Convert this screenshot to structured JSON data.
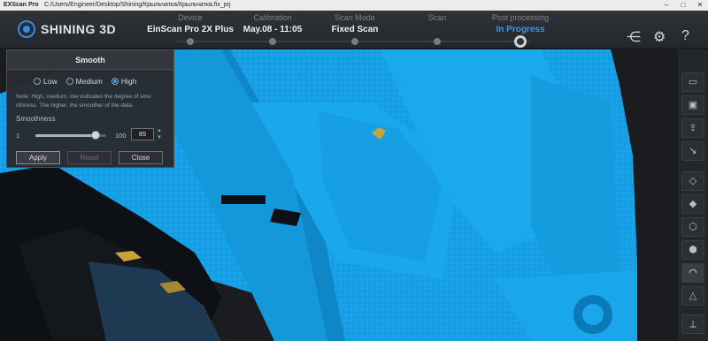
{
  "window": {
    "app_name": "EXScan Pro",
    "path": "C:/Users/Engineer/Desktop/Shining/Крыльчатка/Крыльчатка.fix_prj",
    "min": "–",
    "max": "□",
    "close": "✕"
  },
  "header": {
    "brand": "SHINING 3D",
    "steps": [
      {
        "label": "Device",
        "value": "EinScan Pro 2X Plus"
      },
      {
        "label": "Calibration",
        "value": "May.08 - 11:05"
      },
      {
        "label": "Scan Mode",
        "value": "Fixed Scan"
      },
      {
        "label": "Scan",
        "value": ""
      },
      {
        "label": "Post processing",
        "value": "In Progress"
      }
    ],
    "icons": [
      "share-icon",
      "settings-icon",
      "help-icon"
    ],
    "icon_glyphs": {
      "share": "⋲",
      "settings": "⚙",
      "help": "?"
    }
  },
  "smooth_panel": {
    "title": "Smooth",
    "options": [
      "Low",
      "Medium",
      "High"
    ],
    "selected": "High",
    "note": "Note: High, medium, low indicates the degree of smo othness. The higher, the smoother of the data.",
    "smoothness_label": "Smoothness",
    "min": "1",
    "max": "100",
    "value": "85",
    "slider_fraction": 0.85,
    "buttons": {
      "apply": "Apply",
      "reset": "Reset",
      "close": "Close"
    }
  },
  "sidebar": {
    "tools": [
      "open-folder-icon",
      "save-icon",
      "export-icon",
      "import-icon",
      "cube-front-icon",
      "cube-side-icon",
      "cube-top-icon",
      "cube-iso-icon",
      "smooth-tool-icon",
      "triangle-icon",
      "mirror-icon"
    ],
    "glyphs": [
      "▭",
      "▣",
      "⇪",
      "↘",
      "◇",
      "◆",
      "⬡",
      "⬢",
      "◠",
      "△",
      "⟂"
    ]
  },
  "colors": {
    "mesh_blue": "#17a0e6",
    "mesh_shadow": "#0c6fae",
    "mesh_gold": "#c9a33a",
    "accent": "#2f9cf0"
  }
}
